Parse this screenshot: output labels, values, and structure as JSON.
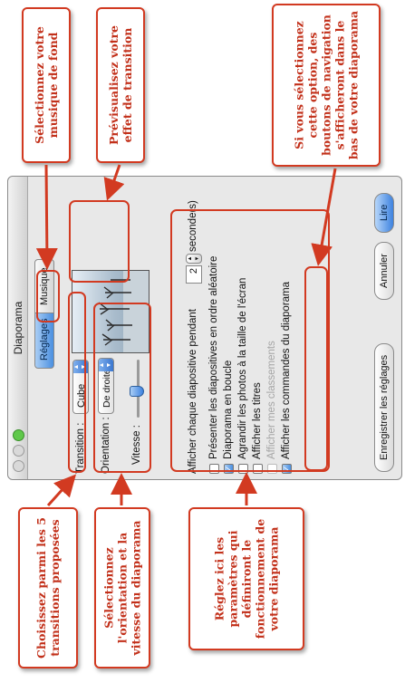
{
  "window": {
    "title": "Diaporama",
    "tabs": [
      {
        "label": "Réglages",
        "selected": true
      },
      {
        "label": "Musique",
        "selected": false
      }
    ],
    "transition_label": "Transition :",
    "transition_value": "Cube",
    "orientation_label": "Orientation :",
    "orientation_value": "De droite à gauche",
    "speed_label": "Vitesse :",
    "speed_fraction": 0.45,
    "duration": {
      "prefix": "Afficher chaque diapositive pendant",
      "value": "2",
      "suffix": "seconde(s)"
    },
    "options": [
      {
        "label": "Présenter les diapositives en ordre aléatoire",
        "checked": false,
        "enabled": true
      },
      {
        "label": "Diaporama en boucle",
        "checked": true,
        "enabled": true
      },
      {
        "label": "Agrandir les photos à la taille de l'écran",
        "checked": false,
        "enabled": true
      },
      {
        "label": "Afficher les titres",
        "checked": false,
        "enabled": true
      },
      {
        "label": "Afficher mes classements",
        "checked": false,
        "enabled": false
      },
      {
        "label": "Afficher les commandes du diaporama",
        "checked": true,
        "enabled": true
      }
    ],
    "buttons": {
      "save": "Enregistrer les réglages",
      "cancel": "Annuler",
      "play": "Lire"
    }
  },
  "callouts": {
    "music": "Sélectionnez votre musique de fond",
    "preview": "Prévisualisez votre effet de transition",
    "controls": "Si vous sélectionnez cette option, des boutons de navigation s'afficheront dans le bas de votre diaporama",
    "transitions": "Choisissez parmi les 5 transitions proposées",
    "orientation": "Sélectionnez l'orientation et la vitesse du diaporama",
    "params": "Réglez ici les paramètres qui définiront le fonctionnement de votre diaporama"
  },
  "colors": {
    "annotation": "#d23a21",
    "accent": "#4a8fe0"
  }
}
